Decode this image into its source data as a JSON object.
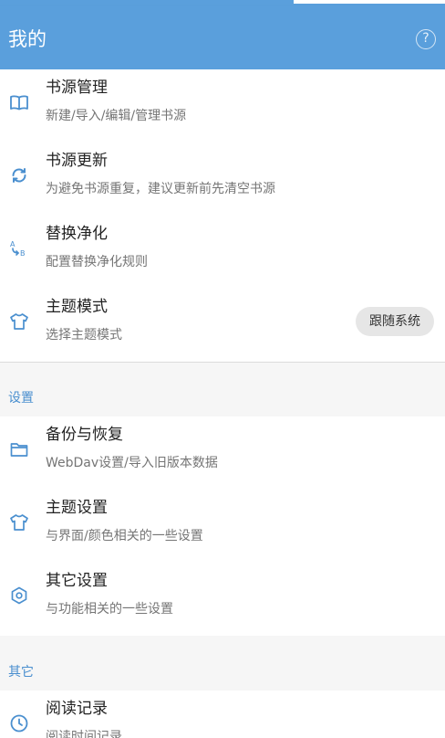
{
  "appbar": {
    "title": "我的",
    "help_glyph": "?"
  },
  "main_items": [
    {
      "title": "书源管理",
      "subtitle": "新建/导入/编辑/管理书源",
      "icon": "book-open-icon"
    },
    {
      "title": "书源更新",
      "subtitle": "为避免书源重复，建议更新前先清空书源",
      "icon": "sync-icon"
    },
    {
      "title": "替换净化",
      "subtitle": "配置替换净化规则",
      "icon": "replace-ab-icon"
    },
    {
      "title": "主题模式",
      "subtitle": "选择主题模式",
      "icon": "tshirt-icon",
      "chip": "跟随系统"
    }
  ],
  "settings_section": {
    "header": "设置",
    "items": [
      {
        "title": "备份与恢复",
        "subtitle": "WebDav设置/导入旧版本数据",
        "icon": "folder-icon"
      },
      {
        "title": "主题设置",
        "subtitle": "与界面/颜色相关的一些设置",
        "icon": "tshirt-icon"
      },
      {
        "title": "其它设置",
        "subtitle": "与功能相关的一些设置",
        "icon": "hexagon-settings-icon"
      }
    ]
  },
  "other_section": {
    "header": "其它",
    "items": [
      {
        "title": "阅读记录",
        "subtitle": "阅读时间记录",
        "icon": "clock-icon"
      }
    ]
  },
  "colors": {
    "primary": "#5a9fdc",
    "accent_text": "#4a8fcf",
    "background": "#f6f6f6"
  }
}
